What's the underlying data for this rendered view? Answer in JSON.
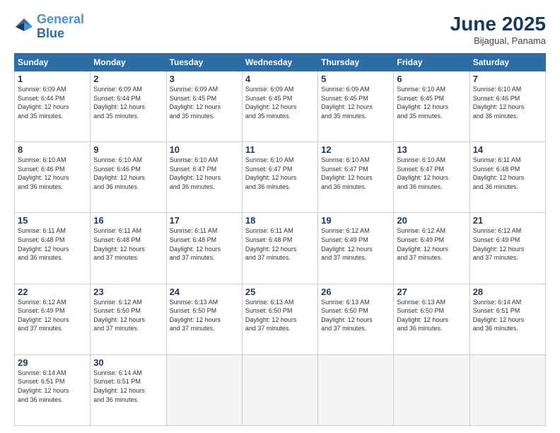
{
  "header": {
    "logo_line1": "General",
    "logo_line2": "Blue",
    "month": "June 2025",
    "location": "Bijagual, Panama"
  },
  "weekdays": [
    "Sunday",
    "Monday",
    "Tuesday",
    "Wednesday",
    "Thursday",
    "Friday",
    "Saturday"
  ],
  "weeks": [
    [
      {
        "day": "1",
        "info": "Sunrise: 6:09 AM\nSunset: 6:44 PM\nDaylight: 12 hours\nand 35 minutes."
      },
      {
        "day": "2",
        "info": "Sunrise: 6:09 AM\nSunset: 6:44 PM\nDaylight: 12 hours\nand 35 minutes."
      },
      {
        "day": "3",
        "info": "Sunrise: 6:09 AM\nSunset: 6:45 PM\nDaylight: 12 hours\nand 35 minutes."
      },
      {
        "day": "4",
        "info": "Sunrise: 6:09 AM\nSunset: 6:45 PM\nDaylight: 12 hours\nand 35 minutes."
      },
      {
        "day": "5",
        "info": "Sunrise: 6:09 AM\nSunset: 6:45 PM\nDaylight: 12 hours\nand 35 minutes."
      },
      {
        "day": "6",
        "info": "Sunrise: 6:10 AM\nSunset: 6:45 PM\nDaylight: 12 hours\nand 35 minutes."
      },
      {
        "day": "7",
        "info": "Sunrise: 6:10 AM\nSunset: 6:46 PM\nDaylight: 12 hours\nand 36 minutes."
      }
    ],
    [
      {
        "day": "8",
        "info": "Sunrise: 6:10 AM\nSunset: 6:46 PM\nDaylight: 12 hours\nand 36 minutes."
      },
      {
        "day": "9",
        "info": "Sunrise: 6:10 AM\nSunset: 6:46 PM\nDaylight: 12 hours\nand 36 minutes."
      },
      {
        "day": "10",
        "info": "Sunrise: 6:10 AM\nSunset: 6:47 PM\nDaylight: 12 hours\nand 36 minutes."
      },
      {
        "day": "11",
        "info": "Sunrise: 6:10 AM\nSunset: 6:47 PM\nDaylight: 12 hours\nand 36 minutes."
      },
      {
        "day": "12",
        "info": "Sunrise: 6:10 AM\nSunset: 6:47 PM\nDaylight: 12 hours\nand 36 minutes."
      },
      {
        "day": "13",
        "info": "Sunrise: 6:10 AM\nSunset: 6:47 PM\nDaylight: 12 hours\nand 36 minutes."
      },
      {
        "day": "14",
        "info": "Sunrise: 6:11 AM\nSunset: 6:48 PM\nDaylight: 12 hours\nand 36 minutes."
      }
    ],
    [
      {
        "day": "15",
        "info": "Sunrise: 6:11 AM\nSunset: 6:48 PM\nDaylight: 12 hours\nand 36 minutes."
      },
      {
        "day": "16",
        "info": "Sunrise: 6:11 AM\nSunset: 6:48 PM\nDaylight: 12 hours\nand 37 minutes."
      },
      {
        "day": "17",
        "info": "Sunrise: 6:11 AM\nSunset: 6:48 PM\nDaylight: 12 hours\nand 37 minutes."
      },
      {
        "day": "18",
        "info": "Sunrise: 6:11 AM\nSunset: 6:48 PM\nDaylight: 12 hours\nand 37 minutes."
      },
      {
        "day": "19",
        "info": "Sunrise: 6:12 AM\nSunset: 6:49 PM\nDaylight: 12 hours\nand 37 minutes."
      },
      {
        "day": "20",
        "info": "Sunrise: 6:12 AM\nSunset: 6:49 PM\nDaylight: 12 hours\nand 37 minutes."
      },
      {
        "day": "21",
        "info": "Sunrise: 6:12 AM\nSunset: 6:49 PM\nDaylight: 12 hours\nand 37 minutes."
      }
    ],
    [
      {
        "day": "22",
        "info": "Sunrise: 6:12 AM\nSunset: 6:49 PM\nDaylight: 12 hours\nand 37 minutes."
      },
      {
        "day": "23",
        "info": "Sunrise: 6:12 AM\nSunset: 6:50 PM\nDaylight: 12 hours\nand 37 minutes."
      },
      {
        "day": "24",
        "info": "Sunrise: 6:13 AM\nSunset: 6:50 PM\nDaylight: 12 hours\nand 37 minutes."
      },
      {
        "day": "25",
        "info": "Sunrise: 6:13 AM\nSunset: 6:50 PM\nDaylight: 12 hours\nand 37 minutes."
      },
      {
        "day": "26",
        "info": "Sunrise: 6:13 AM\nSunset: 6:50 PM\nDaylight: 12 hours\nand 37 minutes."
      },
      {
        "day": "27",
        "info": "Sunrise: 6:13 AM\nSunset: 6:50 PM\nDaylight: 12 hours\nand 36 minutes."
      },
      {
        "day": "28",
        "info": "Sunrise: 6:14 AM\nSunset: 6:51 PM\nDaylight: 12 hours\nand 36 minutes."
      }
    ],
    [
      {
        "day": "29",
        "info": "Sunrise: 6:14 AM\nSunset: 6:51 PM\nDaylight: 12 hours\nand 36 minutes."
      },
      {
        "day": "30",
        "info": "Sunrise: 6:14 AM\nSunset: 6:51 PM\nDaylight: 12 hours\nand 36 minutes."
      },
      {
        "day": "",
        "info": ""
      },
      {
        "day": "",
        "info": ""
      },
      {
        "day": "",
        "info": ""
      },
      {
        "day": "",
        "info": ""
      },
      {
        "day": "",
        "info": ""
      }
    ]
  ]
}
